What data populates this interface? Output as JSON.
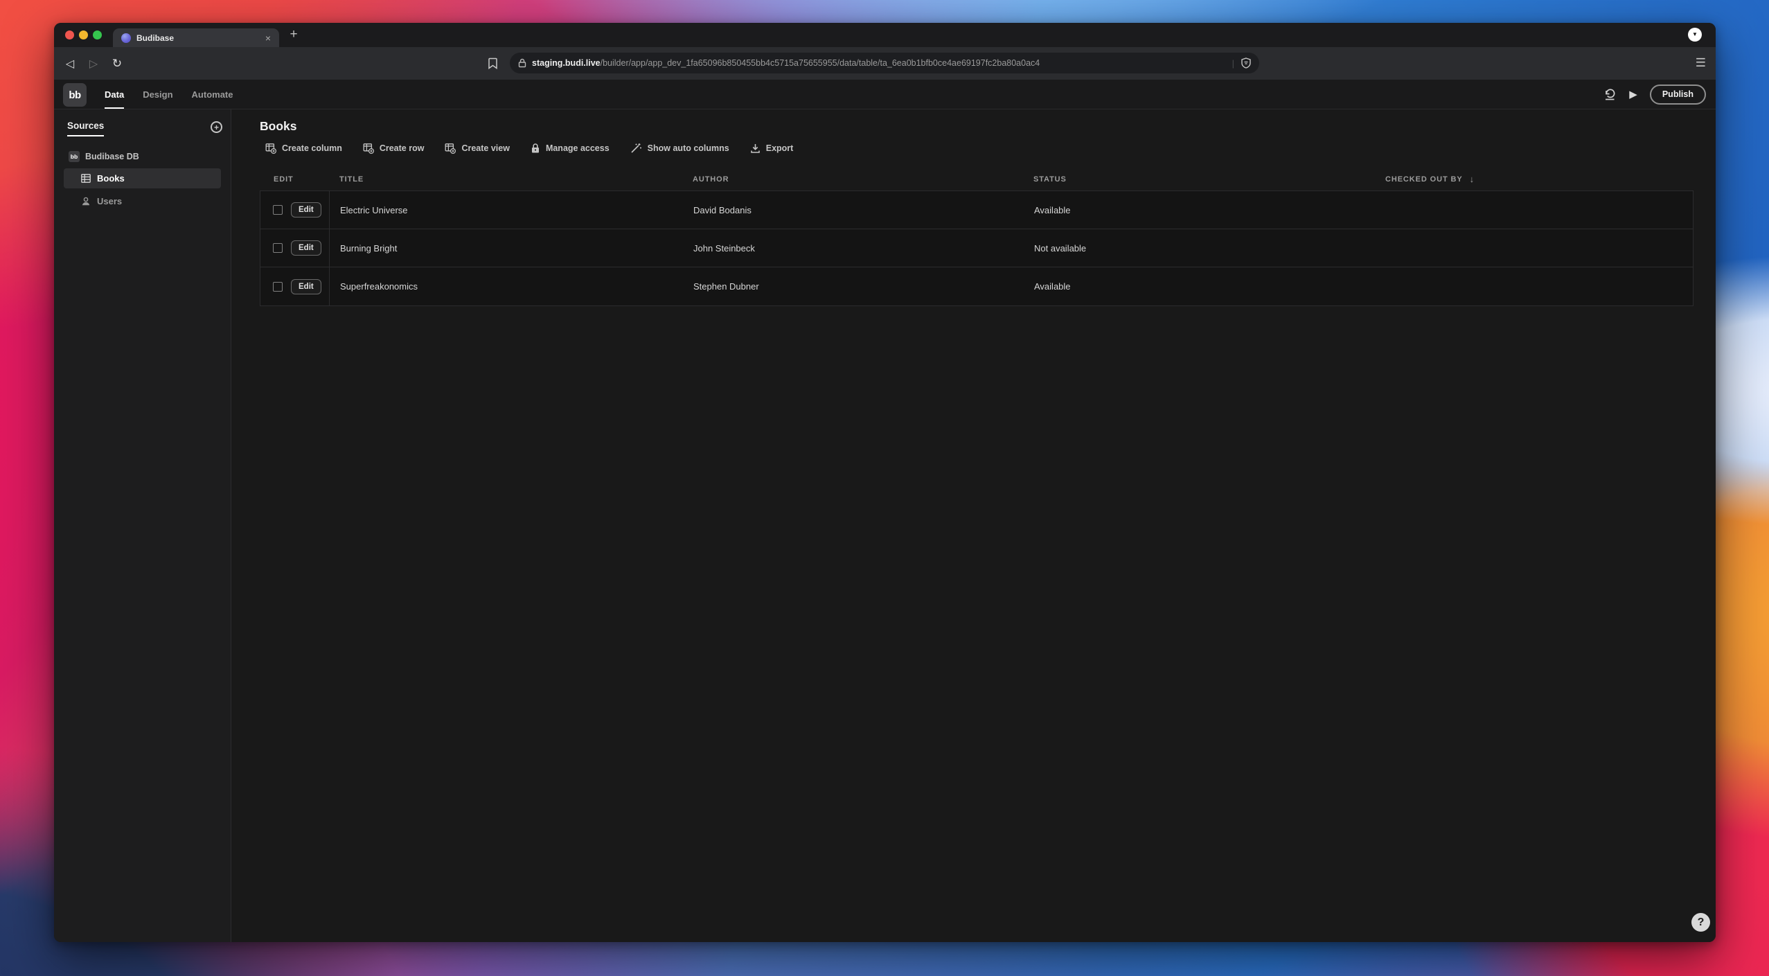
{
  "browser": {
    "tab_title": "Budibase",
    "url_domain": "staging.budi.live",
    "url_path": "/builder/app/app_dev_1fa65096b850455bb4c5715a75655955/data/table/ta_6ea0b1bfb0ce4ae69197fc2ba80a0ac4"
  },
  "icons": {
    "close_tab": "×",
    "new_tab": "+",
    "tab_search": "▼",
    "back": "◁",
    "forward": "▷",
    "reload": "↻",
    "menu": "☰",
    "url_separator": "|",
    "play": "▶",
    "sort_desc": "↓",
    "help": "?",
    "add": "+"
  },
  "app_header": {
    "logo": "bb",
    "nav_tabs": [
      {
        "label": "Data",
        "active": true
      },
      {
        "label": "Design",
        "active": false
      },
      {
        "label": "Automate",
        "active": false
      }
    ],
    "publish_label": "Publish"
  },
  "sidebar": {
    "title": "Sources",
    "items": [
      {
        "label": "Budibase DB",
        "icon": "budibase-db-icon",
        "badge": "bb",
        "selected": false
      },
      {
        "label": "Books",
        "icon": "table-grid-icon",
        "selected": true
      },
      {
        "label": "Users",
        "icon": "users-icon",
        "selected": false
      }
    ]
  },
  "main": {
    "title": "Books",
    "toolbar": [
      {
        "label": "Create column",
        "icon": "table-add-icon"
      },
      {
        "label": "Create row",
        "icon": "table-add-icon"
      },
      {
        "label": "Create view",
        "icon": "table-add-icon"
      },
      {
        "label": "Manage access",
        "icon": "lock-icon"
      },
      {
        "label": "Show auto columns",
        "icon": "magic-wand-icon"
      },
      {
        "label": "Export",
        "icon": "download-icon"
      }
    ],
    "table": {
      "columns": [
        "EDIT",
        "TITLE",
        "AUTHOR",
        "STATUS",
        "CHECKED OUT BY"
      ],
      "sort": {
        "column": "CHECKED OUT BY",
        "direction": "desc"
      },
      "edit_label": "Edit",
      "rows": [
        {
          "title": "Electric Universe",
          "author": "David Bodanis",
          "status": "Available",
          "checked_out_by": ""
        },
        {
          "title": "Burning Bright",
          "author": "John Steinbeck",
          "status": "Not available",
          "checked_out_by": ""
        },
        {
          "title": "Superfreakonomics",
          "author": "Stephen Dubner",
          "status": "Available",
          "checked_out_by": ""
        }
      ]
    }
  },
  "colors": {
    "traffic_red": "#f0564f",
    "traffic_yellow": "#f3b72e",
    "traffic_green": "#35c64e",
    "favicon_purple": "#6b67d8",
    "selected_item_bg": "#2f2f31",
    "active_tab_underline": "#ffffff"
  }
}
